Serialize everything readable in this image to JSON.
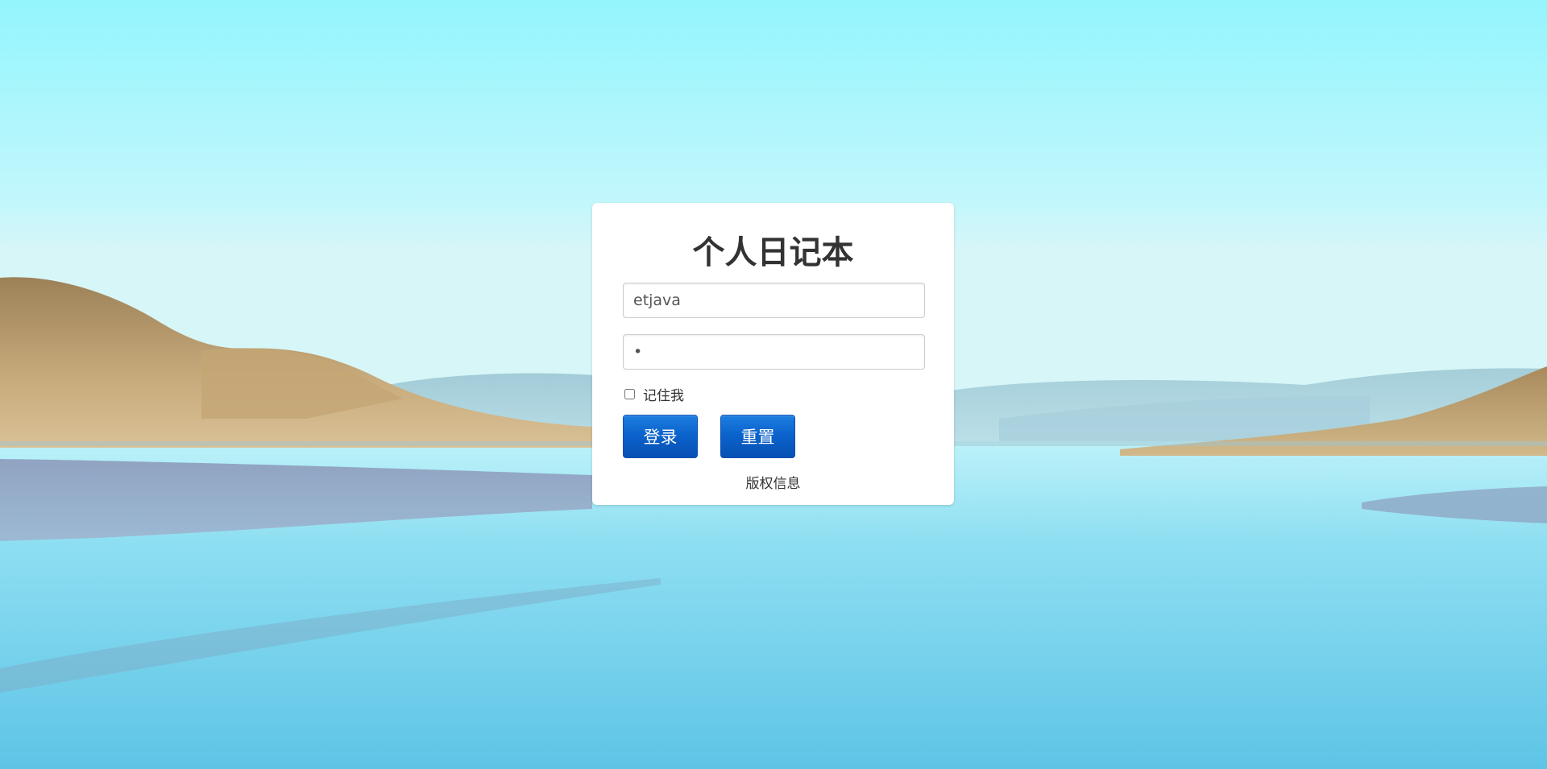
{
  "login": {
    "title": "个人日记本",
    "username_value": "etjava",
    "password_value": "•",
    "remember_label": "记住我",
    "login_label": "登录",
    "reset_label": "重置",
    "copyright_label": "版权信息"
  },
  "colors": {
    "sky_top": "#8ef3fb",
    "sky_bottom": "#c8f6fb",
    "water": "#7fd6ec",
    "hills_grass": "#b59a6b",
    "button_blue": "#0b63cc",
    "card_bg": "#ffffff"
  }
}
